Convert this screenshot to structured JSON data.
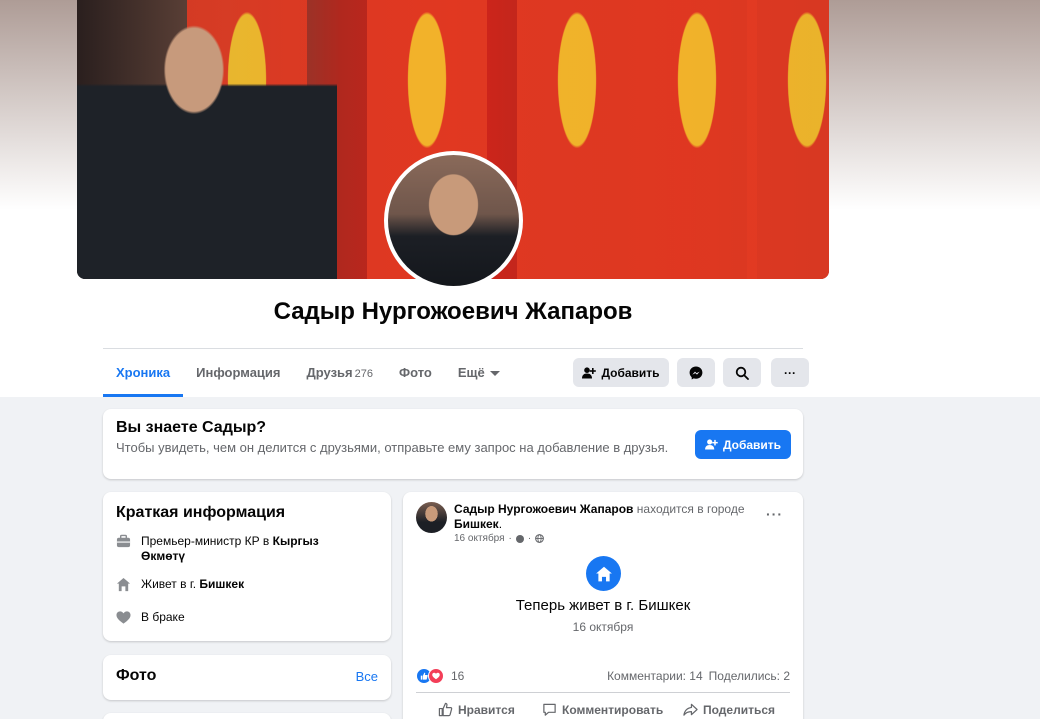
{
  "profile": {
    "name": "Садыр Нургожоевич Жапаров"
  },
  "tabs": [
    {
      "label": "Хроника",
      "count": ""
    },
    {
      "label": "Информация",
      "count": ""
    },
    {
      "label": "Друзья",
      "count": "276"
    },
    {
      "label": "Фото",
      "count": ""
    },
    {
      "label": "Ещё",
      "count": ""
    }
  ],
  "actions": {
    "add_friend_label": "Добавить",
    "messenger_icon": "messenger-icon",
    "search_icon": "search-icon",
    "more_label": "···"
  },
  "know_card": {
    "title": "Вы знаете Садыр?",
    "text": "Чтобы увидеть, чем он делится с друзьями, отправьте ему запрос на добавление в друзья.",
    "button_label": "Добавить"
  },
  "intro": {
    "title": "Краткая информация",
    "work_prefix": "Премьер-министр КР в ",
    "work_place": "Кыргыз Өкмөтү",
    "lives_prefix": "Живет в г. ",
    "lives_city": "Бишкек",
    "relationship": "В браке"
  },
  "photos": {
    "title": "Фото",
    "all_link": "Все"
  },
  "post": {
    "author": "Садыр Нургожоевич Жапаров",
    "status_text": " находится в городе ",
    "city": "Бишкек",
    "period": ".",
    "date": "16 октября",
    "more": "···",
    "life_event": "Теперь живет в г. Бишкек",
    "life_event_date": "16 октября",
    "reactions_count": "16",
    "comments": "Комментарии: 14",
    "shares": "Поделились: 2",
    "like_label": "Нравится",
    "comment_label": "Комментировать",
    "share_label": "Поделиться"
  },
  "colors": {
    "accent": "#1877f2",
    "page_bg": "#f0f2f5",
    "secondary_text": "#65676b"
  }
}
